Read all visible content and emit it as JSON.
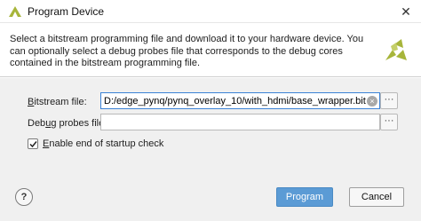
{
  "window": {
    "title": "Program Device",
    "close_glyph": "✕",
    "app_icon": "vivado-logo-icon"
  },
  "header": {
    "description": "Select a bitstream programming file and download it to your hardware device. You can optionally select a debug probes file that corresponds to the debug cores contained in the bitstream programming file.",
    "logo": "xilinx-logo-icon"
  },
  "form": {
    "bitstream": {
      "label": "Bitstream file:",
      "value": "D:/edge_pynq/pynq_overlay_10/with_hdmi/base_wrapper.bit",
      "browse_label": "···",
      "clear_glyph": "×"
    },
    "debug_probes": {
      "label": "Debug probes file:",
      "value": "",
      "browse_label": "···"
    },
    "startup_check": {
      "label": "Enable end of startup check",
      "checked": true
    }
  },
  "footer": {
    "help_label": "?",
    "program_label": "Program",
    "cancel_label": "Cancel"
  },
  "colors": {
    "accent": "#5b9bd5",
    "focus_border": "#3b82d6",
    "panel_bg": "#f0f0f0",
    "logo": "#a7b53a"
  }
}
